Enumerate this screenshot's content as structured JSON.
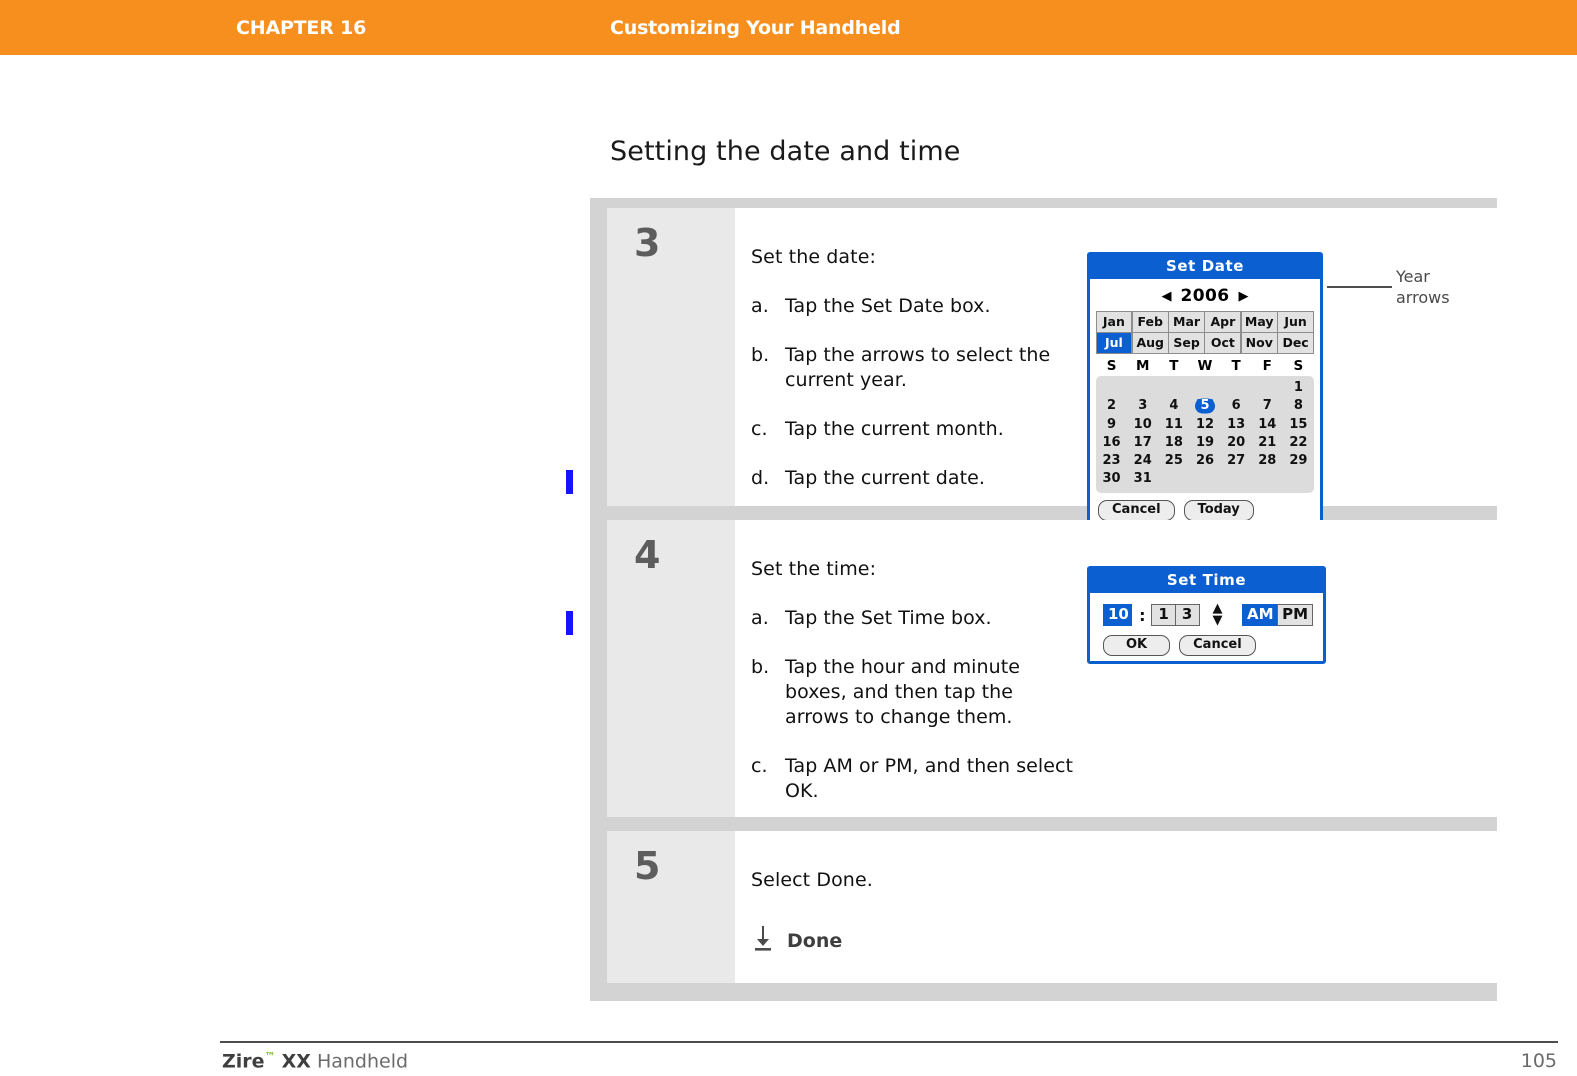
{
  "header": {
    "chapter": "CHAPTER 16",
    "title": "Customizing Your Handheld",
    "bar_color": "#F78F1E"
  },
  "section": {
    "heading": "Setting the date and time"
  },
  "steps": [
    {
      "number": "3",
      "lead": "Set the date:",
      "substeps": [
        {
          "marker": "a.",
          "text": "Tap the Set Date box."
        },
        {
          "marker": "b.",
          "text": "Tap the arrows to select the current year."
        },
        {
          "marker": "c.",
          "text": "Tap the current month."
        },
        {
          "marker": "d.",
          "text": "Tap the current date."
        }
      ]
    },
    {
      "number": "4",
      "lead": "Set the time:",
      "substeps": [
        {
          "marker": "a.",
          "text": "Tap the Set Time box."
        },
        {
          "marker": "b.",
          "text": "Tap the hour and minute boxes, and then tap the arrows to change them."
        },
        {
          "marker": "c.",
          "text": "Tap AM or PM, and then select OK."
        }
      ]
    },
    {
      "number": "5",
      "lead": "Select Done.",
      "substeps": []
    }
  ],
  "set_date_dialog": {
    "title": "Set Date",
    "year": "2006",
    "prev_arrow": "◀",
    "next_arrow": "▶",
    "months": [
      "Jan",
      "Feb",
      "Mar",
      "Apr",
      "May",
      "Jun",
      "Jul",
      "Aug",
      "Sep",
      "Oct",
      "Nov",
      "Dec"
    ],
    "selected_month": "Jul",
    "day_headers": [
      "S",
      "M",
      "T",
      "W",
      "T",
      "F",
      "S"
    ],
    "weeks": [
      [
        "",
        "",
        "",
        "",
        "",
        "",
        "1"
      ],
      [
        "2",
        "3",
        "4",
        "5",
        "6",
        "7",
        "8"
      ],
      [
        "9",
        "10",
        "11",
        "12",
        "13",
        "14",
        "15"
      ],
      [
        "16",
        "17",
        "18",
        "19",
        "20",
        "21",
        "22"
      ],
      [
        "23",
        "24",
        "25",
        "26",
        "27",
        "28",
        "29"
      ],
      [
        "30",
        "31",
        "",
        "",
        "",
        "",
        ""
      ]
    ],
    "selected_day": "5",
    "cancel_label": "Cancel",
    "today_label": "Today",
    "accent_color": "#0B5FD0"
  },
  "callout": {
    "label": "Year\narrows"
  },
  "set_time_dialog": {
    "title": "Set Time",
    "hour": "10",
    "colon": ":",
    "minute_tens": "1",
    "minute_ones": "3",
    "up_arrow": "▲",
    "down_arrow": "▼",
    "am_label": "AM",
    "pm_label": "PM",
    "selected_meridiem": "AM",
    "ok_label": "OK",
    "cancel_label": "Cancel",
    "accent_color": "#0B5FD0"
  },
  "done_item": {
    "label": "Done",
    "icon": "download-arrow-icon"
  },
  "footer": {
    "brand": "Zire",
    "trademark": "™",
    "model": "XX",
    "product": "Handheld",
    "page_number": "105"
  }
}
